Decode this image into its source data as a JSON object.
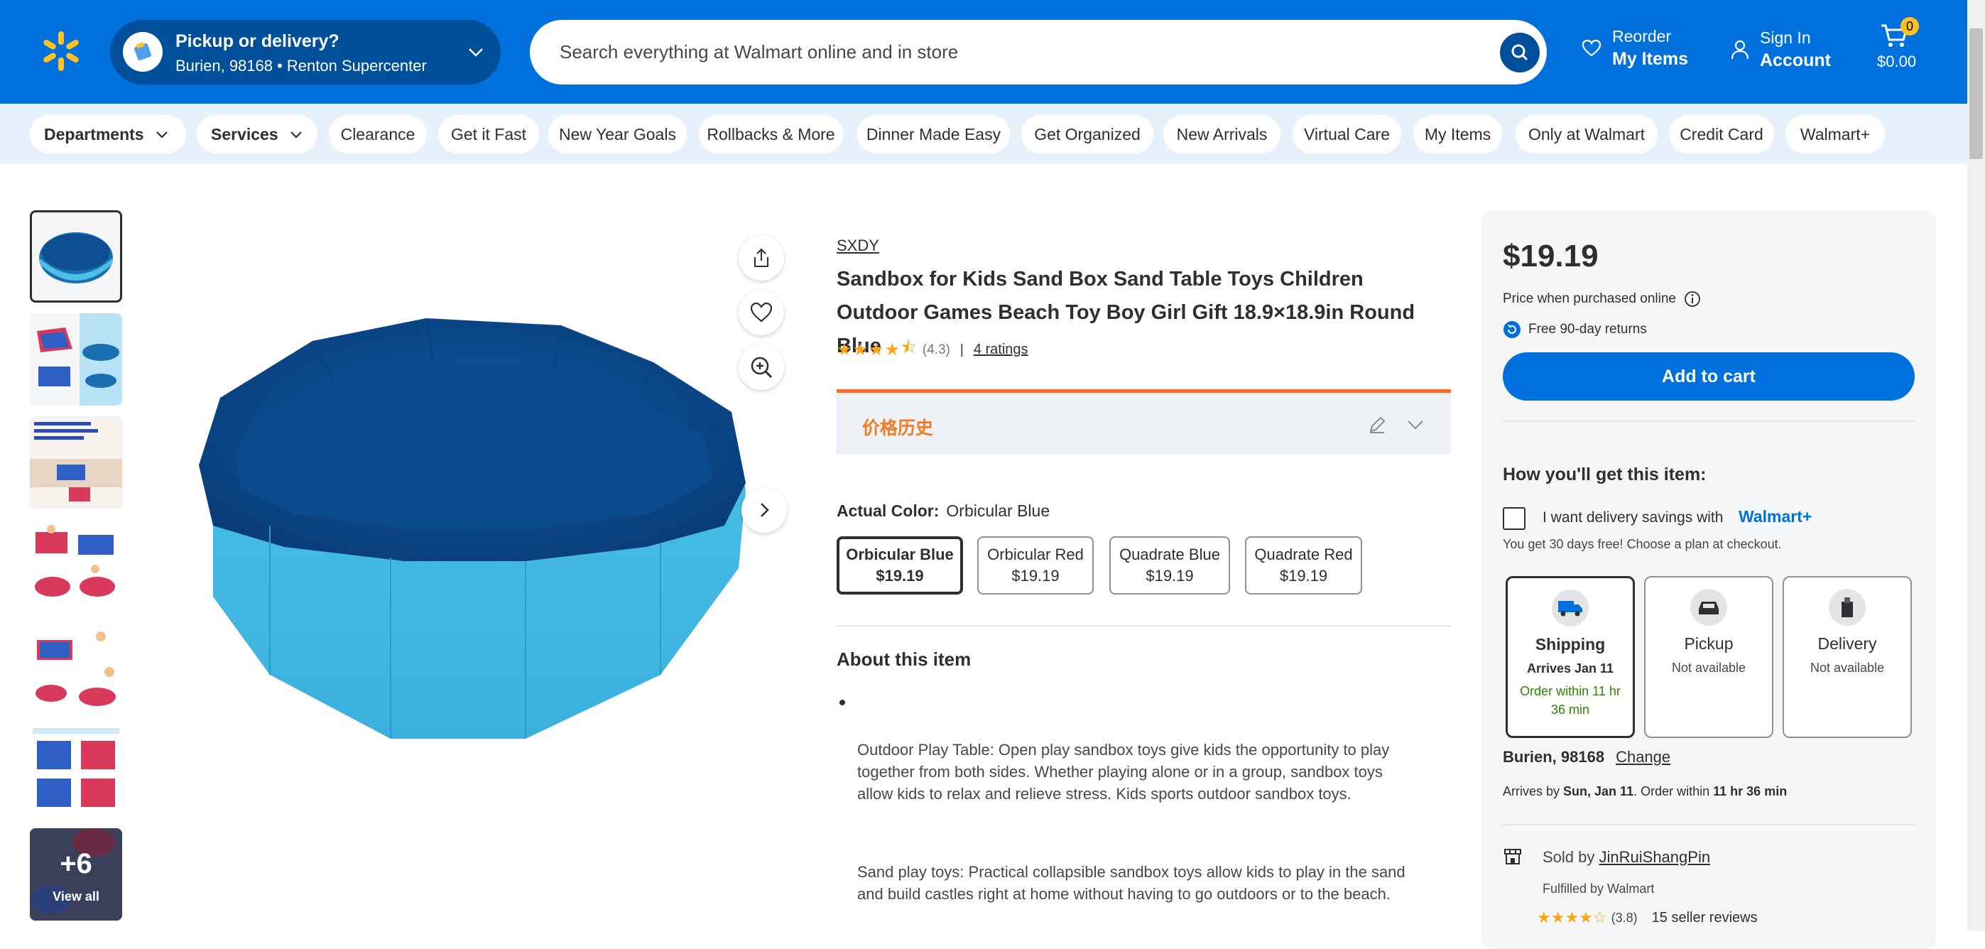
{
  "header": {
    "pickup_title": "Pickup or delivery?",
    "pickup_sub": "Burien, 98168 • Renton Supercenter",
    "search_placeholder": "Search everything at Walmart online and in store",
    "reorder_small": "Reorder",
    "reorder_big": "My Items",
    "signin_small": "Sign In",
    "signin_big": "Account",
    "cart_count": "0",
    "cart_total": "$0.00",
    "brand_color": "#0071dc",
    "spark_color": "#ffc220"
  },
  "subnav": {
    "departments": "Departments",
    "services": "Services",
    "items": [
      "Clearance",
      "Get it Fast",
      "New Year Goals",
      "Rollbacks & More",
      "Dinner Made Easy",
      "Get Organized",
      "New Arrivals",
      "Virtual Care",
      "My Items",
      "Only at Walmart",
      "Credit Card",
      "Walmart+"
    ]
  },
  "gallery": {
    "more_count": "+6",
    "view_all": "View all"
  },
  "product": {
    "brand": "SXDY",
    "title": "Sandbox for Kids Sand Box Sand Table Toys Children Outdoor Games Beach Toy Boy Girl Gift 18.9×18.9in Round Blue",
    "rating_value": "(4.3)",
    "rating_stars": 4.3,
    "ratings_link": "4 ratings",
    "price_history_label": "价格历史",
    "color_label": "Actual Color:",
    "color_value": "Orbicular Blue",
    "swatches": [
      {
        "name": "Orbicular Blue",
        "price": "$19.19"
      },
      {
        "name": "Orbicular Red",
        "price": "$19.19"
      },
      {
        "name": "Quadrate Blue",
        "price": "$19.19"
      },
      {
        "name": "Quadrate Red",
        "price": "$19.19"
      }
    ],
    "about_title": "About this item",
    "paragraphs": [
      "Outdoor Play Table: Open play sandbox toys give kids the opportunity to play together from both sides. Whether playing alone or in a group, sandbox toys allow kids to relax and relieve stress. Kids sports outdoor sandbox toys.",
      "Sand play toys: Practical collapsible sandbox toys allow kids to play in the sand and build castles right at home without having to go outdoors or to the beach."
    ]
  },
  "buybox": {
    "price": "$19.19",
    "price_note": "Price when purchased online",
    "returns": "Free 90-day returns",
    "add_to_cart": "Add to cart",
    "how_title": "How you'll get this item:",
    "delivery_savings": "I want delivery savings with",
    "walmart_plus": "Walmart+",
    "free_trial": "You get 30 days free! Choose a plan at checkout.",
    "options": [
      {
        "title": "Shipping",
        "sub": "Arrives Jan 11",
        "extra": "Order within 11 hr 36 min"
      },
      {
        "title": "Pickup",
        "sub": "Not available",
        "extra": ""
      },
      {
        "title": "Delivery",
        "sub": "Not available",
        "extra": ""
      }
    ],
    "location": "Burien, 98168",
    "change": "Change",
    "arrives_prefix": "Arrives by",
    "arrives_date": "Sun, Jan 11",
    "order_within_prefix": ". Order within",
    "order_within": "11 hr 36 min",
    "sold_by_prefix": "Sold by",
    "seller": "JinRuiShangPin",
    "fulfilled": "Fulfilled by Walmart",
    "seller_rating": "(3.8)",
    "seller_rating_stars": 3.8,
    "seller_reviews": "15 seller reviews"
  }
}
